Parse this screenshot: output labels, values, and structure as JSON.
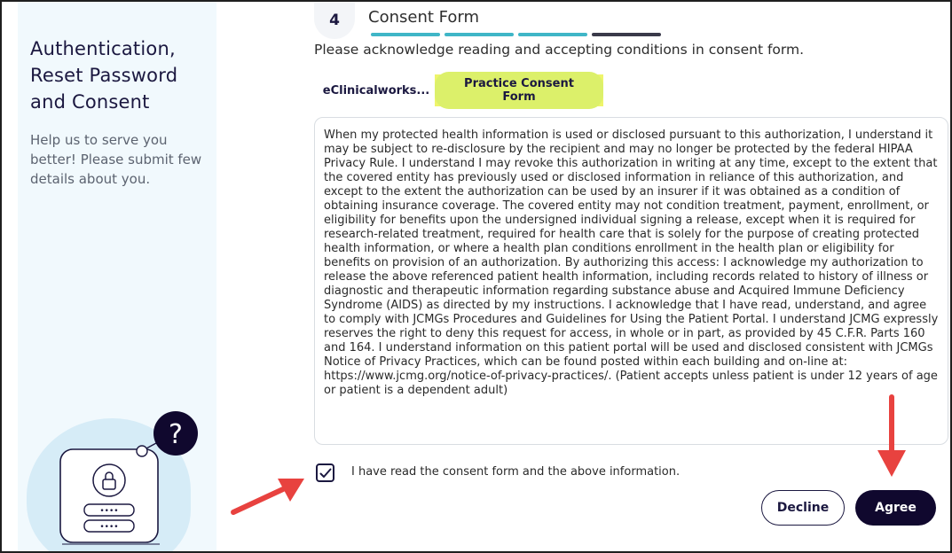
{
  "sidebar": {
    "title": "Authentication, Reset Password and Consent",
    "subtitle": "Help us to serve you better! Please submit few details about you."
  },
  "step": {
    "number": "4",
    "title": "Consent Form",
    "progress_total": 4,
    "progress_completed": 3,
    "instruction": "Please acknowledge reading and accepting conditions in consent form."
  },
  "tabs": [
    {
      "label": "eClinicalworks...",
      "active": false
    },
    {
      "label": "Practice Consent Form",
      "active": true
    }
  ],
  "consent": {
    "text": "When my protected health information is used or disclosed pursuant to this authorization, I understand it may be subject to re-disclosure by the recipient and may no longer be protected by the federal HIPAA Privacy Rule. I understand I may revoke this authorization in writing at any time, except to the extent that the covered entity has previously used or disclosed information in reliance of this authorization, and except to the extent the authorization can be used by an insurer if it was obtained as a condition of obtaining insurance coverage. The covered entity may not condition treatment, payment, enrollment, or eligibility for benefits upon the undersigned individual signing a release, except when it is required for research-related treatment, required for health care that is solely for the purpose of creating protected health information, or where a health plan conditions enrollment in the health plan or eligibility for benefits on provision of an authorization. By authorizing this access: I acknowledge my authorization to release the above referenced patient health information, including records related to history of illness or diagnostic and therapeutic information regarding substance abuse and Acquired Immune Deficiency Syndrome (AIDS) as directed by my instructions. I acknowledge that I have read, understand, and agree to comply with JCMGs Procedures and Guidelines for Using the Patient Portal. I understand JCMG expressly reserves the right to deny this request for access, in whole or in part, as provided by 45 C.F.R. Parts 160 and 164. I understand information on this patient portal will be used and disclosed consistent with JCMGs Notice of Privacy Practices, which can be found posted within each building and on-line at: https://www.jcmg.org/notice-of-privacy-practices/. (Patient accepts unless patient is under 12 years of age or patient is a dependent adult)"
  },
  "agreement": {
    "checked": true,
    "label": "I have read the consent form and the above information."
  },
  "buttons": {
    "decline": "Decline",
    "agree": "Agree"
  },
  "illustration": {
    "question_mark": "?",
    "password_mask_1": "••••",
    "password_mask_2": "••••"
  },
  "colors": {
    "brand_dark": "#10082e",
    "progress_done": "#3fb6c7",
    "progress_current": "#3a3a4a",
    "tab_highlight": "#eef56b",
    "annotation_red": "#e8423f"
  }
}
